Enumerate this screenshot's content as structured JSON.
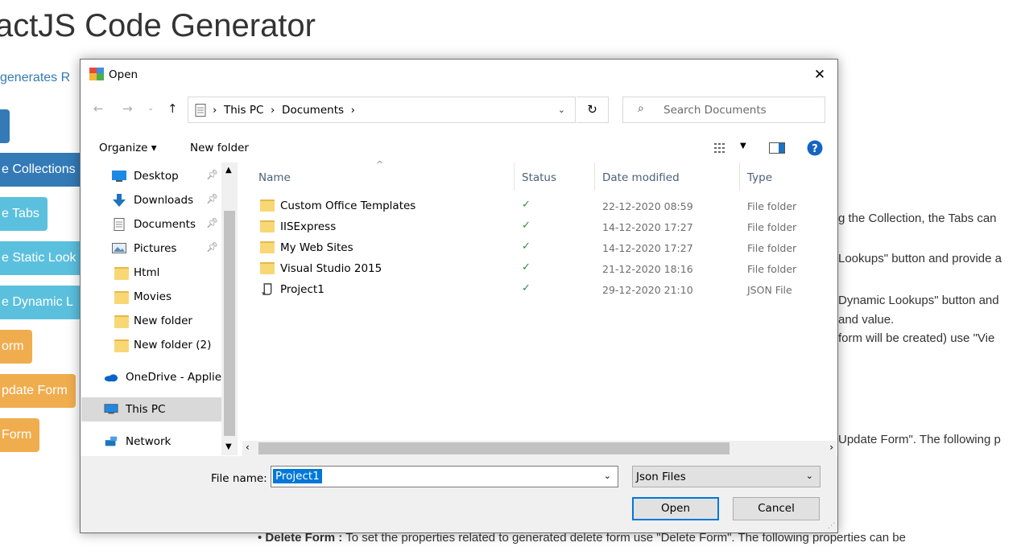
{
  "page": {
    "title": "actJS Code Generator",
    "intro": "generates R",
    "buttons": [
      {
        "label": "e Collections",
        "style": "dark"
      },
      {
        "label": "e Tabs",
        "style": "info"
      },
      {
        "label": "e Static Look",
        "style": "info"
      },
      {
        "label": "e Dynamic L",
        "style": "info"
      },
      {
        "label": "orm",
        "style": "warning"
      },
      {
        "label": "pdate Form",
        "style": "warning"
      },
      {
        "label": " Form",
        "style": "warning"
      }
    ],
    "text_lines": [
      "g the Collection, the Tabs can",
      "Lookups\" button and provide a",
      "Dynamic Lookups\" button and",
      "and value.",
      "form will be created) use \"Vie",
      "Update Form\". The following p"
    ],
    "bullet_term": "Delete Form :",
    "bullet_text": "To set the properties related to generated delete form use \"Delete Form\". The following properties can be"
  },
  "dialog": {
    "title": "Open",
    "close_glyph": "✕",
    "breadcrumb": [
      "This PC",
      "Documents"
    ],
    "search_placeholder": "Search Documents",
    "organize_label": "Organize ▾",
    "new_folder_label": "New folder",
    "nav_items": [
      {
        "label": "Desktop",
        "icon": "desktop-icon",
        "pinned": true
      },
      {
        "label": "Downloads",
        "icon": "download-icon",
        "pinned": true
      },
      {
        "label": "Documents",
        "icon": "documents-icon",
        "pinned": true
      },
      {
        "label": "Pictures",
        "icon": "pictures-icon",
        "pinned": true
      },
      {
        "label": "Html",
        "icon": "folder-icon",
        "pinned": false
      },
      {
        "label": "Movies",
        "icon": "folder-icon",
        "pinned": false
      },
      {
        "label": "New folder",
        "icon": "folder-icon",
        "pinned": false
      },
      {
        "label": "New folder (2)",
        "icon": "folder-icon",
        "pinned": false
      },
      {
        "label": "OneDrive - Applie",
        "icon": "onedrive-icon",
        "pinned": false
      },
      {
        "label": "This PC",
        "icon": "this-pc-icon",
        "pinned": false,
        "selected": true
      },
      {
        "label": "Network",
        "icon": "network-icon",
        "pinned": false
      }
    ],
    "columns": [
      "Name",
      "Status",
      "Date modified",
      "Type"
    ],
    "files": [
      {
        "name": "Custom Office Templates",
        "status": "✓",
        "date": "22-12-2020 08:59",
        "type": "File folder",
        "icon": "folder-icon"
      },
      {
        "name": "IISExpress",
        "status": "✓",
        "date": "14-12-2020 17:27",
        "type": "File folder",
        "icon": "folder-icon"
      },
      {
        "name": "My Web Sites",
        "status": "✓",
        "date": "14-12-2020 17:27",
        "type": "File folder",
        "icon": "folder-icon"
      },
      {
        "name": "Visual Studio 2015",
        "status": "✓",
        "date": "21-12-2020 18:16",
        "type": "File folder",
        "icon": "folder-icon"
      },
      {
        "name": "Project1",
        "status": "✓",
        "date": "29-12-2020 21:10",
        "type": "JSON File",
        "icon": "json-file-icon"
      }
    ],
    "file_name_label": "File name:",
    "file_name_value": "Project1",
    "file_type_value": "Json Files",
    "open_label": "Open",
    "cancel_label": "Cancel"
  }
}
